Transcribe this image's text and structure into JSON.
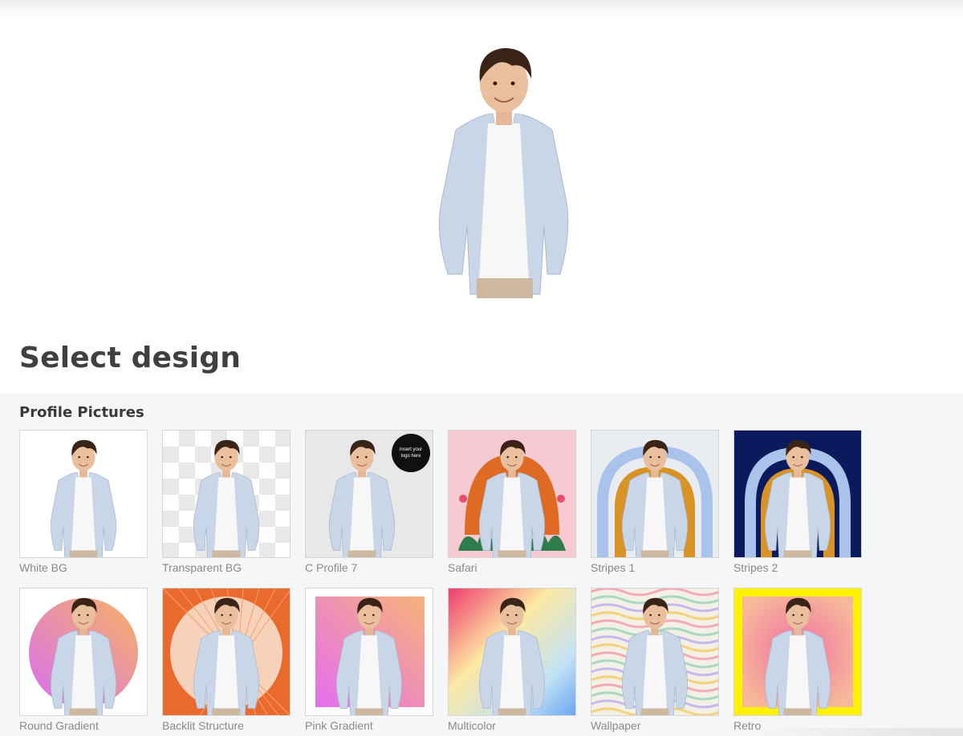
{
  "page": {
    "heading": "Select design"
  },
  "gallery": {
    "section_title": "Profile Pictures",
    "items": [
      {
        "label": "White BG",
        "style": "white"
      },
      {
        "label": "Transparent BG",
        "style": "transparent"
      },
      {
        "label": "C Profile 7",
        "style": "cprofile",
        "logo_text": "Insert your logo here"
      },
      {
        "label": "Safari",
        "style": "safari"
      },
      {
        "label": "Stripes 1",
        "style": "stripes1"
      },
      {
        "label": "Stripes 2",
        "style": "stripes2"
      },
      {
        "label": "Round Gradient",
        "style": "roundgradient"
      },
      {
        "label": "Backlit Structure",
        "style": "backlit"
      },
      {
        "label": "Pink Gradient",
        "style": "pinkgradient"
      },
      {
        "label": "Multicolor",
        "style": "multicolor"
      },
      {
        "label": "Wallpaper",
        "style": "wallpaper"
      },
      {
        "label": "Retro",
        "style": "retro"
      }
    ]
  },
  "colors": {
    "background": "#ffffff",
    "gallery_bg": "#f4f6f7",
    "heading": "#404040",
    "label": "#8a8a8a",
    "jacket": "#c9d6e8",
    "shirt": "#f7f7f7",
    "hair": "#3a2418",
    "skin": "#e9bf9d"
  }
}
